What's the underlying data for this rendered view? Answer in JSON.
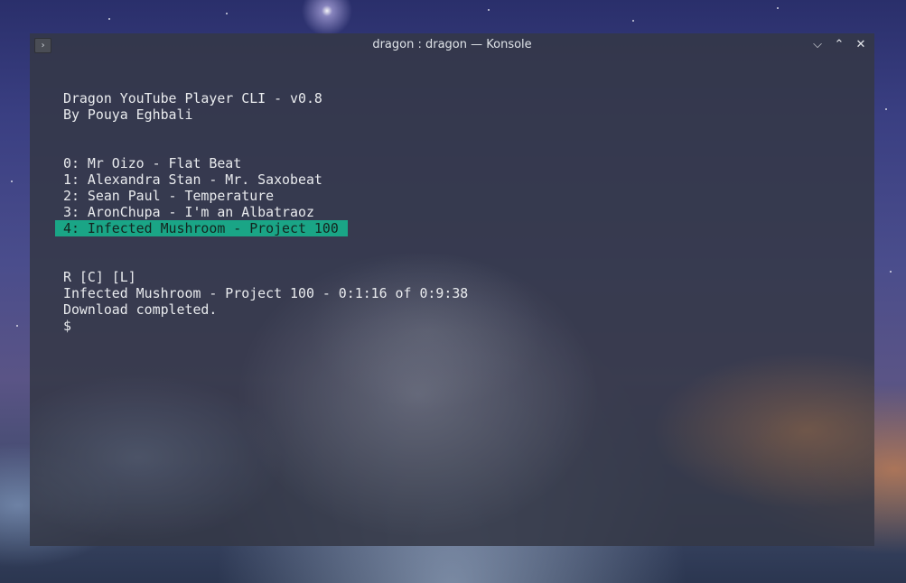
{
  "window": {
    "title": "dragon : dragon — Konsole",
    "controls": {
      "minimize_icon": "⌵",
      "maximize_icon": "⌃",
      "close_icon": "✕"
    }
  },
  "terminal": {
    "header": {
      "title_line": "Dragon YouTube Player CLI - v0.8",
      "author_line": "By Pouya Eghbali"
    },
    "tracks": [
      "0: Mr Oizo - Flat Beat",
      "1: Alexandra Stan - Mr. Saxobeat",
      "2: Sean Paul - Temperature",
      "3: AronChupa - I'm an Albatraoz",
      "4: Infected Mushroom - Project 100"
    ],
    "selected_index": 4,
    "status": {
      "modes": "R [C] [L]",
      "now_playing": "Infected Mushroom - Project 100 - 0:1:16 of 0:9:38",
      "message": "Download completed.",
      "prompt": "$"
    }
  },
  "colors": {
    "selection_bg": "#1aa586",
    "selection_fg": "#14241f",
    "text": "#e9ebee"
  }
}
